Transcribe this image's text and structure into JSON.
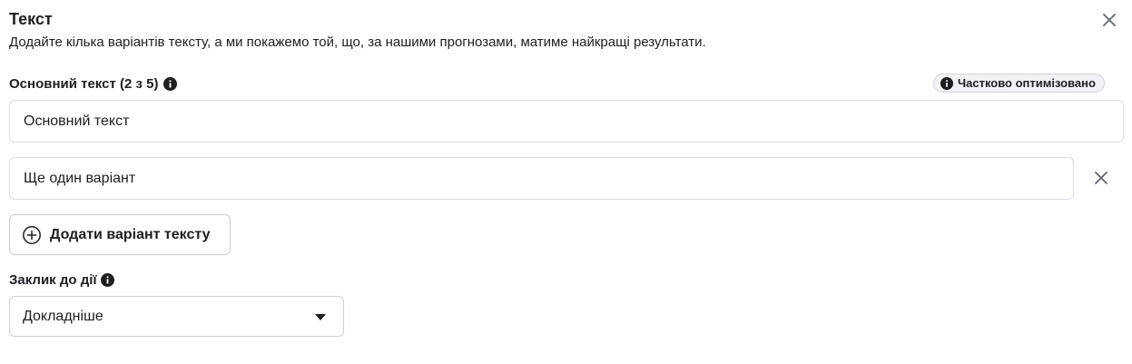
{
  "header": {
    "title": "Текст",
    "subtitle": "Додайте кілька варіантів тексту, а ми покажемо той, що, за нашими прогнозами, матиме найкращі результати."
  },
  "primary_text": {
    "label": "Основний текст (2 з 5)",
    "badge": "Частково оптимізовано",
    "fields": [
      {
        "value": "Основний текст"
      },
      {
        "value": "Ще один варіант"
      }
    ],
    "add_button_label": "Додати варіант тексту"
  },
  "call_to_action": {
    "label": "Заклик до дії",
    "selected": "Докладніше"
  },
  "icons": {
    "close": "close-icon",
    "info": "info-icon",
    "add": "plus-circle-icon",
    "dropdown": "caret-down-icon"
  }
}
